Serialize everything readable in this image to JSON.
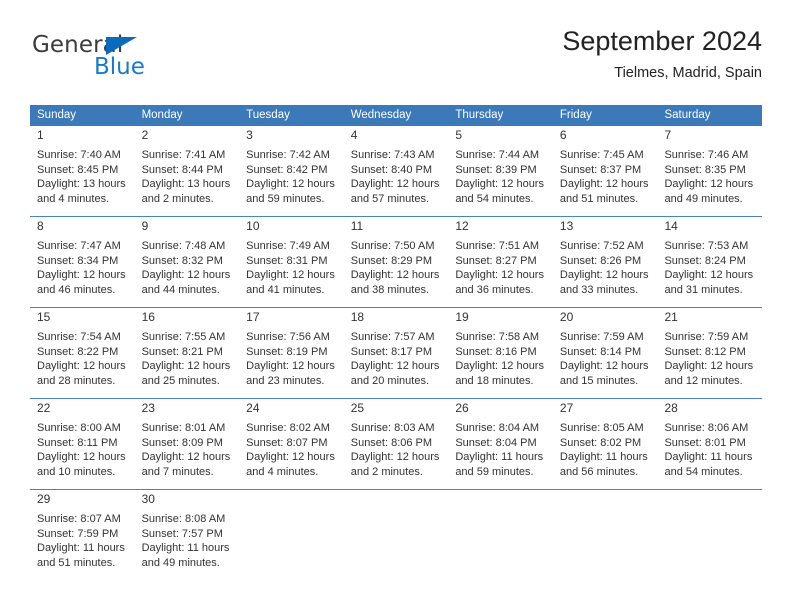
{
  "brand": {
    "name_top": "General",
    "name_bottom": "Blue",
    "triangle_color": "#0a6bbd",
    "text_color": "#3c3c3c",
    "blue_color": "#1a7ac4"
  },
  "header": {
    "title": "September 2024",
    "location": "Tielmes, Madrid, Spain"
  },
  "calendar": {
    "header_bg": "#3b79b8",
    "daynum_band_bg": "#f0f0f0",
    "weekdays": [
      "Sunday",
      "Monday",
      "Tuesday",
      "Wednesday",
      "Thursday",
      "Friday",
      "Saturday"
    ],
    "weeks": [
      [
        {
          "day": "1",
          "sunrise": "Sunrise: 7:40 AM",
          "sunset": "Sunset: 8:45 PM",
          "daylight1": "Daylight: 13 hours",
          "daylight2": "and 4 minutes."
        },
        {
          "day": "2",
          "sunrise": "Sunrise: 7:41 AM",
          "sunset": "Sunset: 8:44 PM",
          "daylight1": "Daylight: 13 hours",
          "daylight2": "and 2 minutes."
        },
        {
          "day": "3",
          "sunrise": "Sunrise: 7:42 AM",
          "sunset": "Sunset: 8:42 PM",
          "daylight1": "Daylight: 12 hours",
          "daylight2": "and 59 minutes."
        },
        {
          "day": "4",
          "sunrise": "Sunrise: 7:43 AM",
          "sunset": "Sunset: 8:40 PM",
          "daylight1": "Daylight: 12 hours",
          "daylight2": "and 57 minutes."
        },
        {
          "day": "5",
          "sunrise": "Sunrise: 7:44 AM",
          "sunset": "Sunset: 8:39 PM",
          "daylight1": "Daylight: 12 hours",
          "daylight2": "and 54 minutes."
        },
        {
          "day": "6",
          "sunrise": "Sunrise: 7:45 AM",
          "sunset": "Sunset: 8:37 PM",
          "daylight1": "Daylight: 12 hours",
          "daylight2": "and 51 minutes."
        },
        {
          "day": "7",
          "sunrise": "Sunrise: 7:46 AM",
          "sunset": "Sunset: 8:35 PM",
          "daylight1": "Daylight: 12 hours",
          "daylight2": "and 49 minutes."
        }
      ],
      [
        {
          "day": "8",
          "sunrise": "Sunrise: 7:47 AM",
          "sunset": "Sunset: 8:34 PM",
          "daylight1": "Daylight: 12 hours",
          "daylight2": "and 46 minutes."
        },
        {
          "day": "9",
          "sunrise": "Sunrise: 7:48 AM",
          "sunset": "Sunset: 8:32 PM",
          "daylight1": "Daylight: 12 hours",
          "daylight2": "and 44 minutes."
        },
        {
          "day": "10",
          "sunrise": "Sunrise: 7:49 AM",
          "sunset": "Sunset: 8:31 PM",
          "daylight1": "Daylight: 12 hours",
          "daylight2": "and 41 minutes."
        },
        {
          "day": "11",
          "sunrise": "Sunrise: 7:50 AM",
          "sunset": "Sunset: 8:29 PM",
          "daylight1": "Daylight: 12 hours",
          "daylight2": "and 38 minutes."
        },
        {
          "day": "12",
          "sunrise": "Sunrise: 7:51 AM",
          "sunset": "Sunset: 8:27 PM",
          "daylight1": "Daylight: 12 hours",
          "daylight2": "and 36 minutes."
        },
        {
          "day": "13",
          "sunrise": "Sunrise: 7:52 AM",
          "sunset": "Sunset: 8:26 PM",
          "daylight1": "Daylight: 12 hours",
          "daylight2": "and 33 minutes."
        },
        {
          "day": "14",
          "sunrise": "Sunrise: 7:53 AM",
          "sunset": "Sunset: 8:24 PM",
          "daylight1": "Daylight: 12 hours",
          "daylight2": "and 31 minutes."
        }
      ],
      [
        {
          "day": "15",
          "sunrise": "Sunrise: 7:54 AM",
          "sunset": "Sunset: 8:22 PM",
          "daylight1": "Daylight: 12 hours",
          "daylight2": "and 28 minutes."
        },
        {
          "day": "16",
          "sunrise": "Sunrise: 7:55 AM",
          "sunset": "Sunset: 8:21 PM",
          "daylight1": "Daylight: 12 hours",
          "daylight2": "and 25 minutes."
        },
        {
          "day": "17",
          "sunrise": "Sunrise: 7:56 AM",
          "sunset": "Sunset: 8:19 PM",
          "daylight1": "Daylight: 12 hours",
          "daylight2": "and 23 minutes."
        },
        {
          "day": "18",
          "sunrise": "Sunrise: 7:57 AM",
          "sunset": "Sunset: 8:17 PM",
          "daylight1": "Daylight: 12 hours",
          "daylight2": "and 20 minutes."
        },
        {
          "day": "19",
          "sunrise": "Sunrise: 7:58 AM",
          "sunset": "Sunset: 8:16 PM",
          "daylight1": "Daylight: 12 hours",
          "daylight2": "and 18 minutes."
        },
        {
          "day": "20",
          "sunrise": "Sunrise: 7:59 AM",
          "sunset": "Sunset: 8:14 PM",
          "daylight1": "Daylight: 12 hours",
          "daylight2": "and 15 minutes."
        },
        {
          "day": "21",
          "sunrise": "Sunrise: 7:59 AM",
          "sunset": "Sunset: 8:12 PM",
          "daylight1": "Daylight: 12 hours",
          "daylight2": "and 12 minutes."
        }
      ],
      [
        {
          "day": "22",
          "sunrise": "Sunrise: 8:00 AM",
          "sunset": "Sunset: 8:11 PM",
          "daylight1": "Daylight: 12 hours",
          "daylight2": "and 10 minutes."
        },
        {
          "day": "23",
          "sunrise": "Sunrise: 8:01 AM",
          "sunset": "Sunset: 8:09 PM",
          "daylight1": "Daylight: 12 hours",
          "daylight2": "and 7 minutes."
        },
        {
          "day": "24",
          "sunrise": "Sunrise: 8:02 AM",
          "sunset": "Sunset: 8:07 PM",
          "daylight1": "Daylight: 12 hours",
          "daylight2": "and 4 minutes."
        },
        {
          "day": "25",
          "sunrise": "Sunrise: 8:03 AM",
          "sunset": "Sunset: 8:06 PM",
          "daylight1": "Daylight: 12 hours",
          "daylight2": "and 2 minutes."
        },
        {
          "day": "26",
          "sunrise": "Sunrise: 8:04 AM",
          "sunset": "Sunset: 8:04 PM",
          "daylight1": "Daylight: 11 hours",
          "daylight2": "and 59 minutes."
        },
        {
          "day": "27",
          "sunrise": "Sunrise: 8:05 AM",
          "sunset": "Sunset: 8:02 PM",
          "daylight1": "Daylight: 11 hours",
          "daylight2": "and 56 minutes."
        },
        {
          "day": "28",
          "sunrise": "Sunrise: 8:06 AM",
          "sunset": "Sunset: 8:01 PM",
          "daylight1": "Daylight: 11 hours",
          "daylight2": "and 54 minutes."
        }
      ],
      [
        {
          "day": "29",
          "sunrise": "Sunrise: 8:07 AM",
          "sunset": "Sunset: 7:59 PM",
          "daylight1": "Daylight: 11 hours",
          "daylight2": "and 51 minutes."
        },
        {
          "day": "30",
          "sunrise": "Sunrise: 8:08 AM",
          "sunset": "Sunset: 7:57 PM",
          "daylight1": "Daylight: 11 hours",
          "daylight2": "and 49 minutes."
        },
        {
          "day": "",
          "sunrise": "",
          "sunset": "",
          "daylight1": "",
          "daylight2": ""
        },
        {
          "day": "",
          "sunrise": "",
          "sunset": "",
          "daylight1": "",
          "daylight2": ""
        },
        {
          "day": "",
          "sunrise": "",
          "sunset": "",
          "daylight1": "",
          "daylight2": ""
        },
        {
          "day": "",
          "sunrise": "",
          "sunset": "",
          "daylight1": "",
          "daylight2": ""
        },
        {
          "day": "",
          "sunrise": "",
          "sunset": "",
          "daylight1": "",
          "daylight2": ""
        }
      ]
    ]
  }
}
